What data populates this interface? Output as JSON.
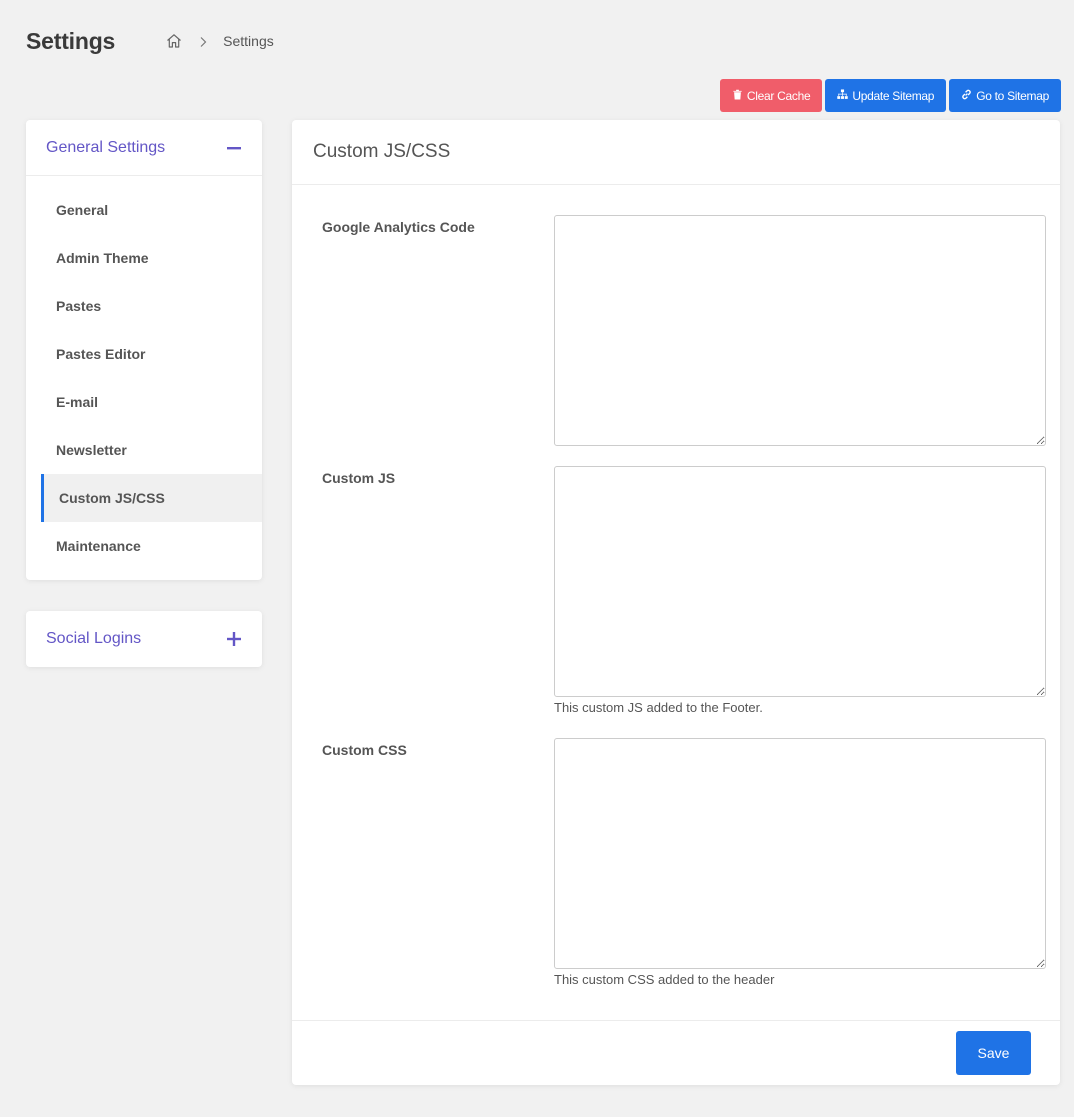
{
  "header": {
    "title": "Settings",
    "breadcrumb": {
      "home_icon": "home-icon",
      "current": "Settings"
    }
  },
  "actions": {
    "clear_cache": {
      "label": "Clear Cache",
      "icon": "trash-icon",
      "color": "#f05d6a"
    },
    "update_sitemap": {
      "label": "Update Sitemap",
      "icon": "sitemap-icon",
      "color": "#1f73e6"
    },
    "go_to_sitemap": {
      "label": "Go to Sitemap",
      "icon": "link-icon",
      "color": "#1f73e6"
    }
  },
  "sidebar": {
    "general": {
      "title": "General Settings",
      "toggle_icon": "minus-icon",
      "items": [
        {
          "label": "General"
        },
        {
          "label": "Admin Theme"
        },
        {
          "label": "Pastes"
        },
        {
          "label": "Pastes Editor"
        },
        {
          "label": "E-mail"
        },
        {
          "label": "Newsletter"
        },
        {
          "label": "Custom JS/CSS",
          "active": true
        },
        {
          "label": "Maintenance"
        }
      ]
    },
    "social": {
      "title": "Social Logins",
      "toggle_icon": "plus-icon"
    }
  },
  "main": {
    "title": "Custom JS/CSS",
    "fields": {
      "ga": {
        "label": "Google Analytics Code",
        "value": ""
      },
      "js": {
        "label": "Custom JS",
        "value": "",
        "help": "This custom JS added to the Footer."
      },
      "css": {
        "label": "Custom CSS",
        "value": "",
        "help": "This custom CSS added to the header"
      }
    },
    "save_label": "Save"
  },
  "colors": {
    "accent": "#6356c6",
    "primary": "#1f73e6",
    "danger": "#f05d6a"
  }
}
